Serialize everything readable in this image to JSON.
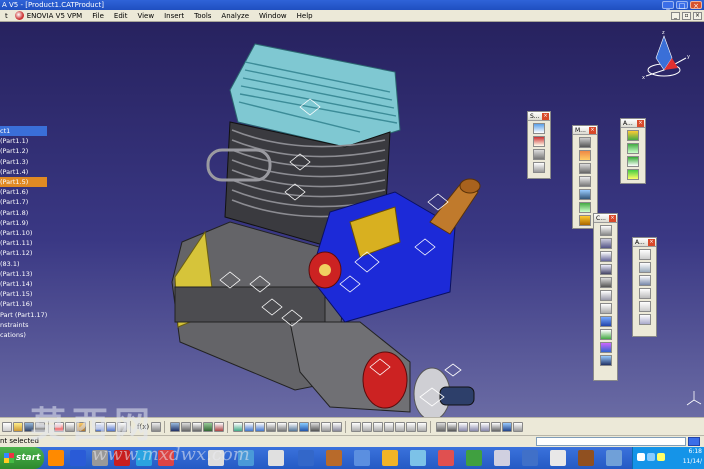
{
  "window": {
    "title": "A V5 - [Product1.CATProduct]"
  },
  "menubar": {
    "items": [
      "t",
      "ENOVIA V5 VPM",
      "File",
      "Edit",
      "View",
      "Insert",
      "Tools",
      "Analyze",
      "Window",
      "Help"
    ]
  },
  "spec_tree": {
    "items": [
      "ct1",
      "(Part1.1)",
      "(Part1.2)",
      "(Part1.3)",
      "(Part1.4)",
      "(Part1.5)",
      "(Part1.6)",
      "(Part1.7)",
      "(Part1.8)",
      "(Part1.9)",
      "(Part1.10)",
      "(Part1.11)",
      "(Part1.12)",
      "(83.1)",
      "(Part1.13)",
      "(Part1.14)",
      "(Part1.15)",
      "(Part1.16)",
      "Part (Part1.17)",
      "nstraints",
      "cations)"
    ],
    "selected_index": 0,
    "highlighted_index": 5
  },
  "floating_toolbars": [
    {
      "title": "S..."
    },
    {
      "title": "M..."
    },
    {
      "title": "A..."
    },
    {
      "title": "C..."
    },
    {
      "title": "A..."
    }
  ],
  "bottom_toolbar": {
    "formula_label": "f(x)"
  },
  "status": {
    "text": "nt selected"
  },
  "taskbar": {
    "start_label": "start",
    "clock_time": "6:18",
    "clock_date": "11/14/"
  },
  "watermark": {
    "text": "莫西网",
    "url": "www.mxdwx.com"
  },
  "colors": {
    "titlebar": "#1f4fc0",
    "viewport_top": "#27225f",
    "viewport_bottom": "#6a6ba4",
    "tree_selected": "#3a6fd8",
    "tree_highlight": "#e08a23",
    "taskbar": "#245ac4"
  }
}
